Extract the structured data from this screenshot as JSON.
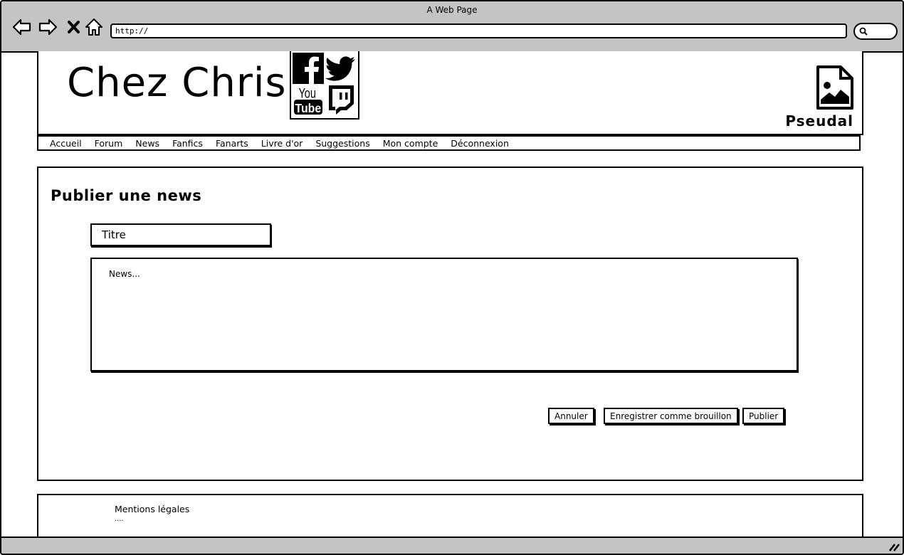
{
  "browser": {
    "window_title": "A Web Page",
    "url": "http://"
  },
  "header": {
    "site_title": "Chez Chris",
    "social": [
      {
        "name": "facebook-icon"
      },
      {
        "name": "twitter-icon"
      },
      {
        "name": "youtube-icon",
        "text_top": "You",
        "text_bottom": "Tube"
      },
      {
        "name": "twitch-icon"
      }
    ],
    "username": "Pseudal"
  },
  "nav": {
    "items": [
      "Accueil",
      "Forum",
      "News",
      "Fanfics",
      "Fanarts",
      "Livre d'or",
      "Suggestions",
      "Mon compte",
      "Déconnexion"
    ]
  },
  "main": {
    "page_title": "Publier une news",
    "title_placeholder": "Titre",
    "news_placeholder": "News...",
    "buttons": {
      "cancel": "Annuler",
      "save_draft": "Enregistrer comme brouillon",
      "publish": "Publier"
    }
  },
  "footer": {
    "legal": "Mentions légales",
    "more": "...."
  }
}
